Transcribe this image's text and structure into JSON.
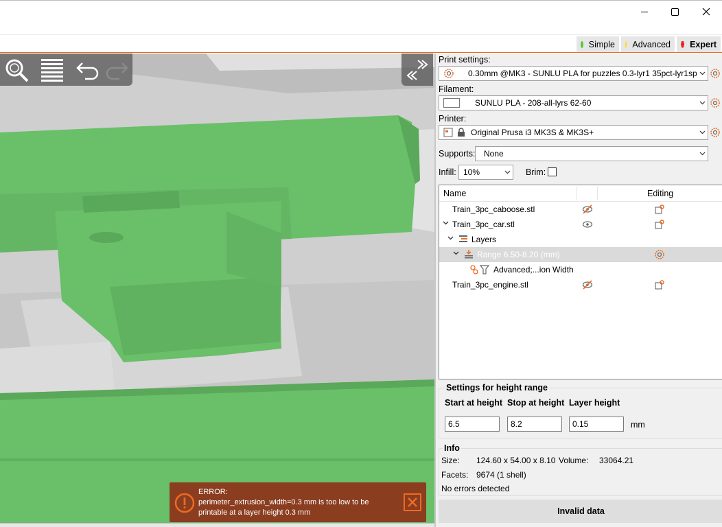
{
  "colors": {
    "accent": "#ed6b21",
    "model_green": "#6abf69",
    "bed_gray": "#d2d2d2",
    "error_bg": "#8b3d20"
  },
  "modes": [
    {
      "label": "Simple",
      "color": "#55cc33"
    },
    {
      "label": "Advanced",
      "color": "#ffdd11"
    },
    {
      "label": "Expert",
      "color": "#e8211f"
    }
  ],
  "toolbar": {
    "icons": [
      "zoom-icon",
      "layers-icon",
      "undo-icon",
      "redo-icon"
    ],
    "collapse_icon": "collapse-sidebar-icon"
  },
  "error": {
    "title": "ERROR:",
    "line1": "perimeter_extrusion_width=0.3 mm is too low to be",
    "line2": "printable at a layer height 0.3 mm"
  },
  "panel": {
    "print_settings": {
      "label": "Print settings:",
      "value": "0.30mm @MK3 - SUNLU PLA for puzzles 0.3-lyr1 35pct-lyr1sp"
    },
    "filament": {
      "label": "Filament:",
      "value": "SUNLU PLA - 208-all-lyrs 62-60"
    },
    "printer": {
      "label": "Printer:",
      "value": "Original Prusa i3 MK3S & MK3S+"
    },
    "supports": {
      "label": "Supports:",
      "value": "None"
    },
    "infill": {
      "label": "Infill:",
      "value": "10%"
    },
    "brim": {
      "label": "Brim:",
      "checked": false
    }
  },
  "object_list": {
    "headers": {
      "name": "Name",
      "editing": "Editing"
    },
    "rows": [
      {
        "name": "Train_3pc_caboose.stl",
        "visible": false
      },
      {
        "name": "Train_3pc_car.stl",
        "visible": true
      },
      {
        "name": "Layers"
      },
      {
        "name": "Range 6.50-8.20 (mm)"
      },
      {
        "name": "Advanced;...ion Width"
      },
      {
        "name": "Train_3pc_engine.stl",
        "visible": false
      }
    ]
  },
  "height_range": {
    "title": "Settings for height range",
    "start_label": "Start at height",
    "stop_label": "Stop at height",
    "layer_label": "Layer height",
    "start": "6.5",
    "stop": "8.2",
    "layer": "0.15",
    "unit": "mm"
  },
  "info": {
    "title": "Info",
    "size_label": "Size:",
    "size_value": "124.60 x 54.00 x 8.10",
    "volume_label": "Volume:",
    "volume_value": "33064.21",
    "facets_label": "Facets:",
    "facets_value": "9674 (1 shell)",
    "status": "No errors detected"
  },
  "action_button": "Invalid data"
}
